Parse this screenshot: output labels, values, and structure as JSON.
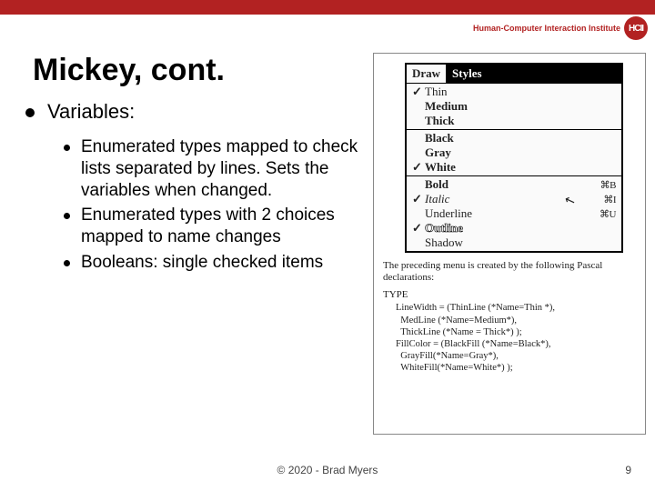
{
  "header": {
    "institute": "Human-Computer Interaction Institute",
    "logo_text": "HCII"
  },
  "title": "Mickey, cont.",
  "bullets": {
    "l1": "Variables:",
    "l2a": "Enumerated types mapped to check lists separated by lines. Sets the variables when changed.",
    "l2b": "Enumerated types with 2 choices mapped to name changes",
    "l2c": "Booleans: single checked items"
  },
  "figure": {
    "header_draw": "Draw",
    "header_styles": "Styles",
    "section1": [
      {
        "check": "✓",
        "label": "Thin"
      },
      {
        "check": "",
        "label": "Medium",
        "bold": true
      },
      {
        "check": "",
        "label": "Thick",
        "bold": true
      }
    ],
    "section2": [
      {
        "check": "",
        "label": "Black",
        "bold": true
      },
      {
        "check": "",
        "label": "Gray",
        "bold": true
      },
      {
        "check": "✓",
        "label": "White",
        "bold": true
      }
    ],
    "section3": [
      {
        "check": "",
        "label": "Bold",
        "bold": true,
        "shortcut": "⌘B"
      },
      {
        "check": "✓",
        "label": "Italic",
        "italic": true,
        "shortcut": "⌘I"
      },
      {
        "check": "",
        "label": "Underline",
        "shortcut": "⌘U"
      },
      {
        "check": "✓",
        "label": "Outline",
        "outline": true
      },
      {
        "check": "",
        "label": "Shadow"
      }
    ],
    "caption": "The preceding menu is created by the following Pascal declarations:",
    "type_kw": "TYPE",
    "pascal": "LineWidth = (ThinLine (*Name=Thin *),\n  MedLine (*Name=Medium*),\n  ThickLine (*Name = Thick*) );\nFillColor = (BlackFill (*Name=Black*),\n  GrayFill(*Name=Gray*),\n  WhiteFill(*Name=White*) );"
  },
  "footer": {
    "copyright": "© 2020 - Brad Myers",
    "page": "9"
  }
}
